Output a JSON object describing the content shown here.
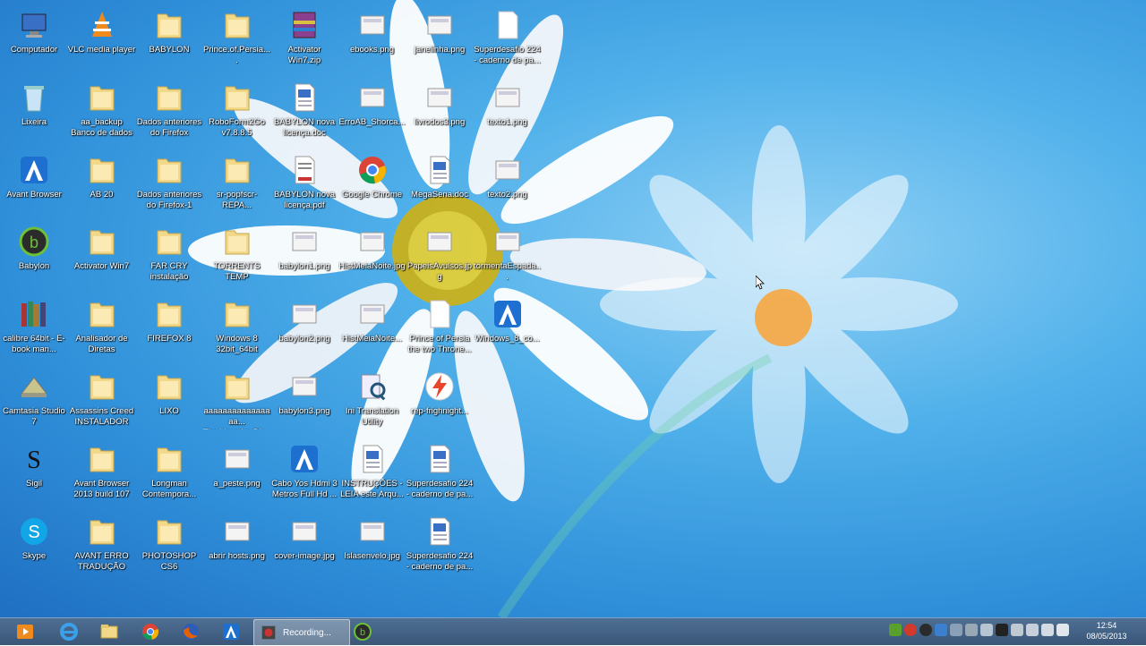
{
  "desktop": {
    "icons": [
      {
        "label": "Computador",
        "type": "computer"
      },
      {
        "label": "Lixeira",
        "type": "recycle"
      },
      {
        "label": "Avant Browser",
        "type": "avant"
      },
      {
        "label": "Babylon",
        "type": "babylon"
      },
      {
        "label": "calibre 64bit - E-book man...",
        "type": "books"
      },
      {
        "label": "Camtasia Studio 7",
        "type": "camtasia"
      },
      {
        "label": "Sigil",
        "type": "sigil"
      },
      {
        "label": "Skype",
        "type": "skype"
      },
      {
        "label": "VLC media player",
        "type": "vlc"
      },
      {
        "label": "aa_backup Banco de dados",
        "type": "folder"
      },
      {
        "label": "AB 20",
        "type": "folder"
      },
      {
        "label": "Activator Win7",
        "type": "folder"
      },
      {
        "label": "Analisador de Diretas",
        "type": "folder"
      },
      {
        "label": "Assassins Creed INSTALADOR",
        "type": "folder"
      },
      {
        "label": "Avant Browser 2013 build 107",
        "type": "folder"
      },
      {
        "label": "AVANT ERRO TRADUÇÃO",
        "type": "folder"
      },
      {
        "label": "BABYLON",
        "type": "folder"
      },
      {
        "label": "Dados anteriores do Firefox",
        "type": "folder"
      },
      {
        "label": "Dados anteriores do Firefox-1",
        "type": "folder"
      },
      {
        "label": "FAR CRY instalação",
        "type": "folder"
      },
      {
        "label": "FIREFOX 8",
        "type": "folder"
      },
      {
        "label": "LIXO",
        "type": "folder"
      },
      {
        "label": "Longman Contempora...",
        "type": "folder"
      },
      {
        "label": "PHOTOSHOP CS6",
        "type": "folder"
      },
      {
        "label": "Prince.of.Persia....",
        "type": "folder"
      },
      {
        "label": "RoboForm2Go v7.8.8.5",
        "type": "folder"
      },
      {
        "label": "sr-popfscr-REPA...",
        "type": "folder"
      },
      {
        "label": "TORRENTS TEMP",
        "type": "folder"
      },
      {
        "label": "Windows 8 32bit_64bit",
        "type": "folder"
      },
      {
        "label": "aaaaaaaaaaaaaaaa... The.Vampire.Dia...",
        "type": "folder"
      },
      {
        "label": "a_peste.png",
        "type": "image"
      },
      {
        "label": "abrir hosts.png",
        "type": "image"
      },
      {
        "label": "Activator Win7.zip",
        "type": "zip"
      },
      {
        "label": "BABYLON nova licença.doc",
        "type": "doc"
      },
      {
        "label": "BABYLON nova licença.pdf",
        "type": "pdf"
      },
      {
        "label": "babylon1.png",
        "type": "image"
      },
      {
        "label": "babylon2.png",
        "type": "image"
      },
      {
        "label": "babylon3.png",
        "type": "image"
      },
      {
        "label": "Cabo Yos Hdmi 3 Metros Full Hd ...",
        "type": "avant"
      },
      {
        "label": "cover-image.jpg",
        "type": "image"
      },
      {
        "label": "ebooks.png",
        "type": "image"
      },
      {
        "label": "ErroAB_Shorca...",
        "type": "image"
      },
      {
        "label": "Google Chrome",
        "type": "chrome"
      },
      {
        "label": "HistMeiaNoite.jpg",
        "type": "image"
      },
      {
        "label": "HistMeiaNoite...",
        "type": "image"
      },
      {
        "label": "Ini Translation Utility",
        "type": "ini"
      },
      {
        "label": "INSTRUÇÕES - LEIA este Arqu...",
        "type": "doc"
      },
      {
        "label": "Islasenvelo.jpg",
        "type": "image"
      },
      {
        "label": "janelinha.png",
        "type": "image"
      },
      {
        "label": "livrodos3.png",
        "type": "image"
      },
      {
        "label": "MegaSena.doc",
        "type": "doc"
      },
      {
        "label": "PapeisAvulsos.jpg",
        "type": "image"
      },
      {
        "label": "Prince of Persia the two Throne...",
        "type": "file"
      },
      {
        "label": "rep-frighnight...",
        "type": "flash"
      },
      {
        "label": "Superdesafio 224 - caderno de pa...",
        "type": "doc"
      },
      {
        "label": "Superdesafio 224 - caderno de pa...",
        "type": "doc"
      },
      {
        "label": "Superdesafio 224 - caderno de pa...",
        "type": "file"
      },
      {
        "label": "texto1.png",
        "type": "image"
      },
      {
        "label": "texto2.png",
        "type": "image"
      },
      {
        "label": "tormentaEspada...",
        "type": "image"
      },
      {
        "label": "Windows_8_co...",
        "type": "avant"
      }
    ]
  },
  "taskbar": {
    "apps": [
      "start-media",
      "internet-explorer",
      "file-explorer",
      "chrome",
      "firefox",
      "avant-browser"
    ],
    "active_window_label": "Recording...",
    "clock_time": "12:54",
    "clock_date": "08/05/2013"
  },
  "colors": {
    "folder": "#f2d98a",
    "taskbar": "#3f5d80",
    "accent": "#1f6fc2"
  }
}
